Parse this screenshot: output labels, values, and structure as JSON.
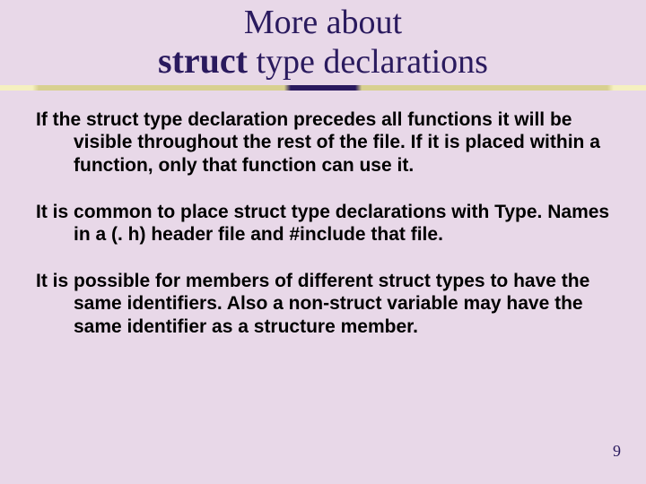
{
  "title": {
    "line1": "More about",
    "struct_word": "struct",
    "line2_rest": " type declarations"
  },
  "paragraphs": [
    "If the struct type declaration precedes all functions it will be visible throughout the rest of the file.  If it is placed within a function, only that function can use it.",
    "It is common to place struct type declarations with Type. Names in a (. h) header file and #include that file.",
    "It is possible for members of different struct types to have the same identifiers.  Also a non-struct variable may have the same identifier as a structure member."
  ],
  "page_number": "9"
}
